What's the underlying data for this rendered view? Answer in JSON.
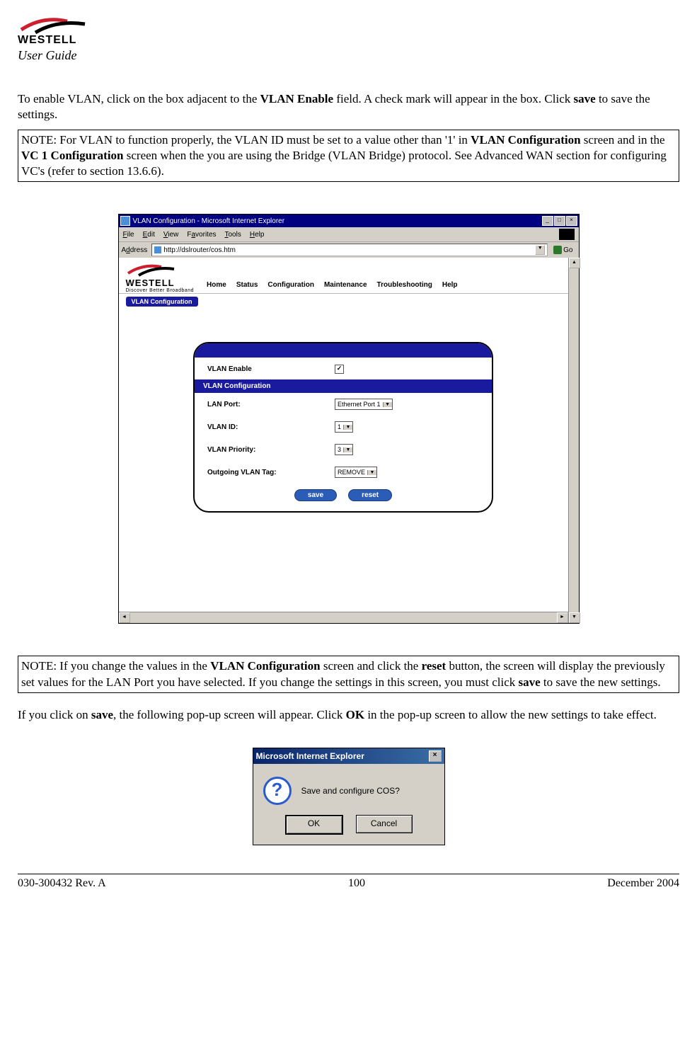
{
  "header": {
    "brand": "WESTELL",
    "doc_label": "User Guide"
  },
  "para1_prefix": "To enable VLAN, click on the box adjacent to the ",
  "para1_bold1": "VLAN Enable",
  "para1_mid": " field. A check mark will appear in the box. Click ",
  "para1_bold2": "save",
  "para1_suffix": " to save the settings.",
  "note1_prefix": "NOTE: For VLAN to function properly, the VLAN ID must be set to a value other than '1' in ",
  "note1_bold1": "VLAN Configuration",
  "note1_mid1": " screen and in the ",
  "note1_bold2": "VC 1 Configuration",
  "note1_suffix": " screen when the you are using the Bridge (VLAN Bridge) protocol. See Advanced WAN section for configuring VC's (refer to section 13.6.6).",
  "ie": {
    "title": "VLAN Configuration - Microsoft Internet Explorer",
    "menu": {
      "file": "File",
      "edit": "Edit",
      "view": "View",
      "favorites": "Favorites",
      "tools": "Tools",
      "help": "Help"
    },
    "address_label": "Address",
    "url": "http://dslrouter/cos.htm",
    "go": "Go"
  },
  "router": {
    "brand": "WESTELL",
    "tagline": "Discover Better Broadband",
    "nav": {
      "home": "Home",
      "status": "Status",
      "config": "Configuration",
      "maint": "Maintenance",
      "trouble": "Troubleshooting",
      "help": "Help"
    },
    "subtab": "VLAN Configuration",
    "enable_label": "VLAN Enable",
    "section_heading": "VLAN Configuration",
    "lanport_label": "LAN Port:",
    "lanport_value": "Ethernet Port 1",
    "vlanid_label": "VLAN ID:",
    "vlanid_value": "1",
    "priority_label": "VLAN Priority:",
    "priority_value": "3",
    "tag_label": "Outgoing VLAN Tag:",
    "tag_value": "REMOVE",
    "save_btn": "save",
    "reset_btn": "reset"
  },
  "note2_prefix": "NOTE: If you change the values in the ",
  "note2_bold1": "VLAN Configuration",
  "note2_mid1": " screen and click the ",
  "note2_bold2": "reset",
  "note2_mid2": " button, the screen will display the previously set values for the LAN Port you have selected. If you change the settings in this screen, you must click ",
  "note2_bold3": "save",
  "note2_suffix": " to save the new settings.",
  "para2_prefix": "If you click on ",
  "para2_bold1": "save",
  "para2_mid": ", the following pop-up screen will appear. Click ",
  "para2_bold2": "OK",
  "para2_suffix": " in the pop-up screen to allow the new settings to take effect.",
  "popup": {
    "title": "Microsoft Internet Explorer",
    "message": "Save and configure COS?",
    "ok": "OK",
    "cancel": "Cancel"
  },
  "footer": {
    "left": "030-300432 Rev. A",
    "center": "100",
    "right": "December 2004"
  }
}
